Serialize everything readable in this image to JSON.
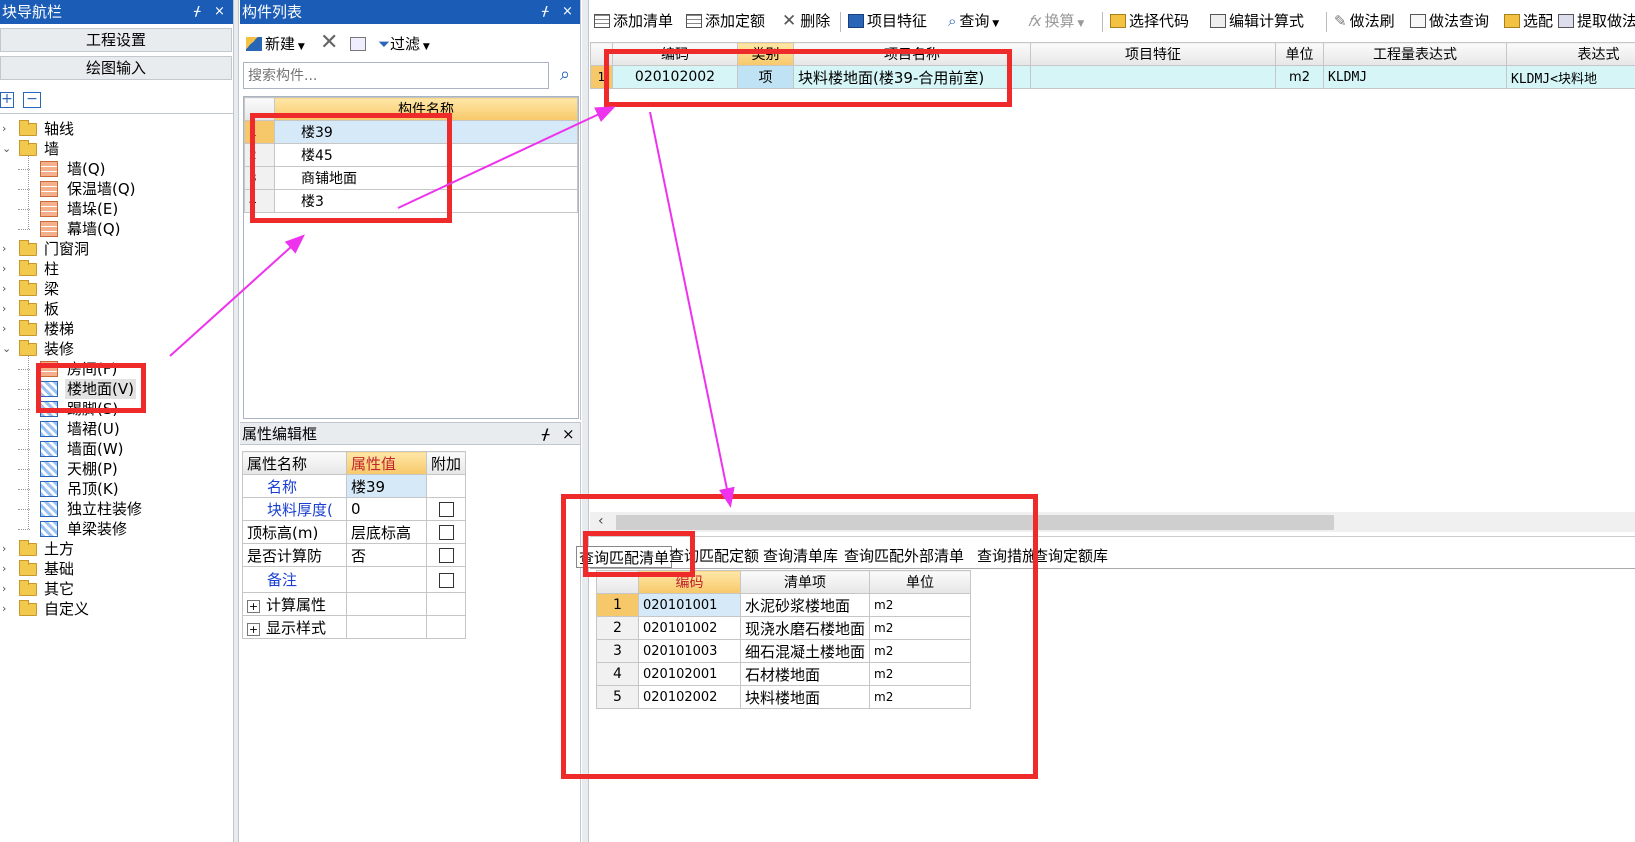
{
  "nav": {
    "title": "块导航栏",
    "pin": "ᚋ",
    "close": "×",
    "btn_project": "工程设置",
    "btn_draw": "绘图输入",
    "add": "+",
    "minus": "−",
    "tree": [
      {
        "label": "轴线",
        "exp": "›"
      },
      {
        "label": "墙",
        "exp": "⌄"
      },
      {
        "label": "墙(Q)"
      },
      {
        "label": "保温墙(Q)"
      },
      {
        "label": "墙垛(E)"
      },
      {
        "label": "幕墙(Q)"
      },
      {
        "label": "门窗洞",
        "exp": "›"
      },
      {
        "label": "柱",
        "exp": "›"
      },
      {
        "label": "梁",
        "exp": "›"
      },
      {
        "label": "板",
        "exp": "›"
      },
      {
        "label": "楼梯",
        "exp": "›"
      },
      {
        "label": "装修",
        "exp": "⌄"
      },
      {
        "label": "房间(F)"
      },
      {
        "label": "楼地面(V)"
      },
      {
        "label": "踢脚(S)"
      },
      {
        "label": "墙裙(U)"
      },
      {
        "label": "墙面(W)"
      },
      {
        "label": "天棚(P)"
      },
      {
        "label": "吊顶(K)"
      },
      {
        "label": "独立柱装修"
      },
      {
        "label": "单梁装修"
      },
      {
        "label": "土方",
        "exp": "›"
      },
      {
        "label": "基础",
        "exp": "›"
      },
      {
        "label": "其它",
        "exp": "›"
      },
      {
        "label": "自定义",
        "exp": "›"
      }
    ]
  },
  "components": {
    "title": "构件列表",
    "new": "新建",
    "filter": "过滤",
    "search_placeholder": "搜索构件...",
    "col_name": "构件名称",
    "rows": [
      {
        "n": "1",
        "name": "楼39"
      },
      {
        "n": "2",
        "name": "楼45"
      },
      {
        "n": "3",
        "name": "商铺地面"
      },
      {
        "n": "4",
        "name": "楼3"
      }
    ]
  },
  "props": {
    "title": "属性编辑框",
    "col_name": "属性名称",
    "col_value": "属性值",
    "col_extra": "附加",
    "rows": [
      {
        "name": "名称",
        "value": "楼39"
      },
      {
        "name": "块料厚度(",
        "value": "0"
      },
      {
        "name": "顶标高(m)",
        "value": "层底标高"
      },
      {
        "name": "是否计算防",
        "value": "否"
      },
      {
        "name": "备注",
        "value": ""
      },
      {
        "name": "计算属性",
        "value": ""
      },
      {
        "name": "显示样式",
        "value": ""
      }
    ]
  },
  "toolbar": {
    "add_list": "添加清单",
    "add_quota": "添加定额",
    "delete": "删除",
    "item_feature": "项目特征",
    "query": "查询",
    "convert": "换算",
    "select_code": "选择代码",
    "edit_formula": "编辑计算式",
    "method_brush": "做法刷",
    "method_query": "做法查询",
    "select_match": "选配",
    "extract": "提取做法"
  },
  "bill": {
    "headers": [
      "编码",
      "类别",
      "项目名称",
      "项目特征",
      "单位",
      "工程量表达式",
      "表达式"
    ],
    "row": {
      "n": "1",
      "code": "020102002",
      "type": "项",
      "name": "块料楼地面(楼39-合用前室)",
      "feature": "",
      "unit": "m2",
      "expr": "KLDMJ",
      "expr_desc": "KLDMJ<块料地"
    }
  },
  "query": {
    "tabs": [
      "查询匹配清单",
      "查询匹配定额",
      "查询清单库",
      "查询匹配外部清单",
      "查询措施",
      "查询定额库"
    ],
    "headers": [
      "编码",
      "清单项",
      "单位"
    ],
    "rows": [
      {
        "n": "1",
        "code": "020101001",
        "item": "水泥砂浆楼地面",
        "unit": "m2"
      },
      {
        "n": "2",
        "code": "020101002",
        "item": "现浇水磨石楼地面",
        "unit": "m2"
      },
      {
        "n": "3",
        "code": "020101003",
        "item": "细石混凝土楼地面",
        "unit": "m2"
      },
      {
        "n": "4",
        "code": "020102001",
        "item": "石材楼地面",
        "unit": "m2"
      },
      {
        "n": "5",
        "code": "020102002",
        "item": "块料楼地面",
        "unit": "m2"
      }
    ]
  },
  "colors": {
    "title_blue": "#1b5cb6",
    "annotation_red": "#ee2a2a",
    "arrow_magenta": "#ee33ee",
    "header_orange": "#f7c869"
  }
}
